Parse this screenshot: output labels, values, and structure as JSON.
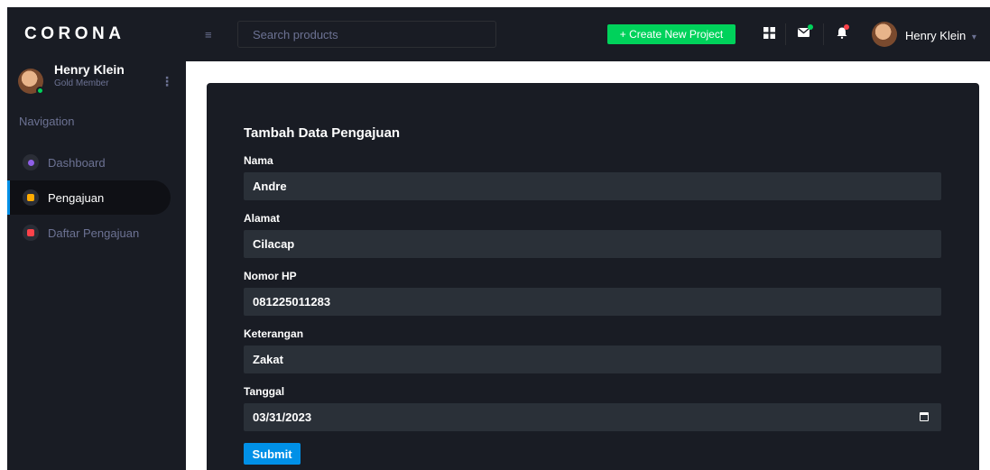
{
  "brand": "CORONA",
  "profile": {
    "name": "Henry Klein",
    "level": "Gold Member"
  },
  "sidebar": {
    "nav_title": "Navigation",
    "items": [
      {
        "label": "Dashboard",
        "icon": "dashboard-icon",
        "color": "#8f5fe8"
      },
      {
        "label": "Pengajuan",
        "icon": "document-icon",
        "color": "#ffab00"
      },
      {
        "label": "Daftar Pengajuan",
        "icon": "table-icon",
        "color": "#fc424a"
      }
    ]
  },
  "topbar": {
    "search_placeholder": "Search products",
    "create_label": "+ Create New Project",
    "user_name": "Henry Klein"
  },
  "form": {
    "title": "Tambah Data Pengajuan",
    "fields": [
      {
        "label": "Nama",
        "value": "Andre"
      },
      {
        "label": "Alamat",
        "value": "Cilacap"
      },
      {
        "label": "Nomor HP",
        "value": "081225011283"
      },
      {
        "label": "Keterangan",
        "value": "Zakat"
      },
      {
        "label": "Tanggal",
        "value": "03/31/2023"
      }
    ],
    "submit_label": "Submit"
  },
  "colors": {
    "accent_blue": "#0090e7",
    "success_green": "#00d25b",
    "danger_red": "#fc424a",
    "sidebar_bg": "#191c24"
  }
}
